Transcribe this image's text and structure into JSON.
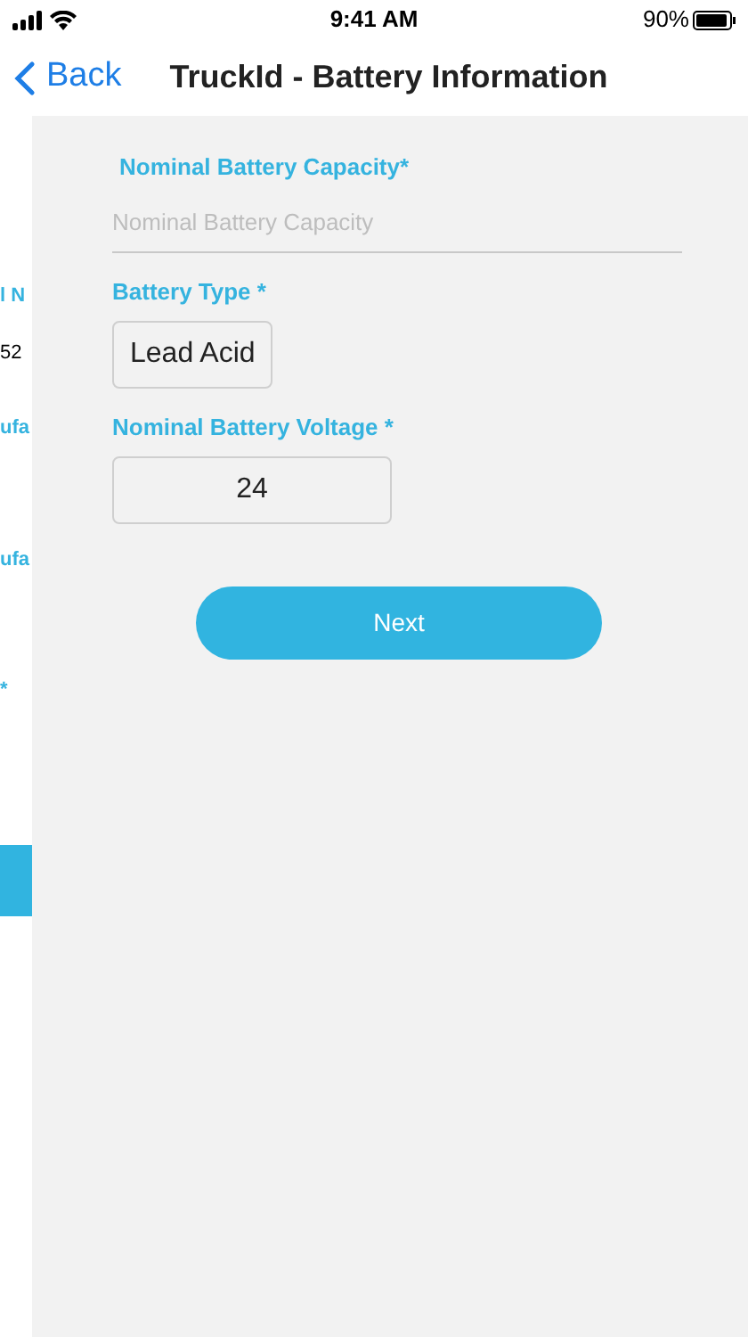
{
  "status_bar": {
    "time": "9:41 AM",
    "battery": "90%"
  },
  "nav": {
    "back": "Back",
    "title": "TruckId - Battery Information"
  },
  "previous_page": {
    "fragments": [
      {
        "kind": "label",
        "text": "l N"
      },
      {
        "kind": "value",
        "text": "52"
      },
      {
        "kind": "label",
        "text": "ufa"
      },
      {
        "kind": "label",
        "text": "ufa"
      },
      {
        "kind": "label",
        "text": "*"
      }
    ]
  },
  "form": {
    "fields": [
      {
        "kind": "text",
        "label": "Nominal Battery Capacity*",
        "placeholder": "Nominal Battery Capacity"
      },
      {
        "kind": "select",
        "label": "Battery Type *",
        "value": "Lead Acid"
      },
      {
        "kind": "select_wide",
        "label": "Nominal Battery Voltage *",
        "value": "24"
      }
    ],
    "button": "Next"
  }
}
